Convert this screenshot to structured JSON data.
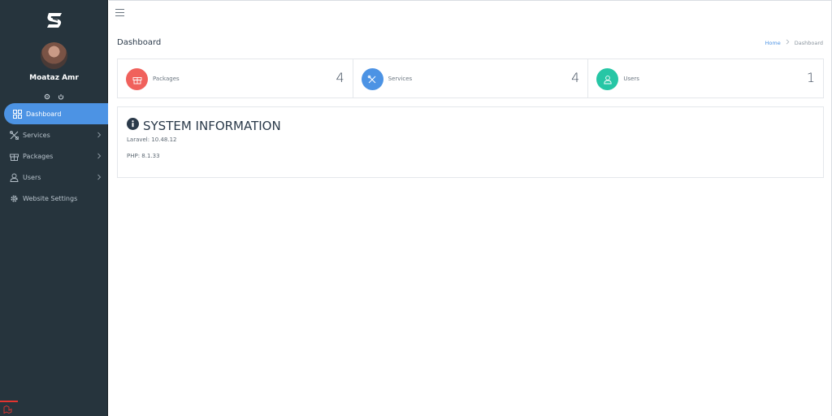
{
  "sidebar": {
    "username": "Moataz Amr",
    "menu": [
      {
        "label": "Dashboard",
        "icon": "grid-icon",
        "active": true,
        "has_children": false
      },
      {
        "label": "Services",
        "icon": "tools-icon",
        "active": false,
        "has_children": true
      },
      {
        "label": "Packages",
        "icon": "gift-icon",
        "active": false,
        "has_children": true
      },
      {
        "label": "Users",
        "icon": "user-icon",
        "active": false,
        "has_children": true
      },
      {
        "label": "Website Settings",
        "icon": "gear-icon",
        "active": false,
        "has_children": false
      }
    ]
  },
  "header": {
    "title": "Dashboard",
    "breadcrumb": {
      "home": "Home",
      "current": "Dashboard"
    }
  },
  "stats": [
    {
      "label": "Packages",
      "count": "4",
      "color": "#f0615c",
      "icon": "gift-icon"
    },
    {
      "label": "Services",
      "count": "4",
      "color": "#4c93e4",
      "icon": "tools-icon"
    },
    {
      "label": "Users",
      "count": "1",
      "color": "#26c6a5",
      "icon": "user-icon"
    }
  ],
  "system_info": {
    "title": "SYSTEM INFORMATION",
    "laravel": "Laravel: 10.48.12",
    "php": "PHP: 8.1.33"
  },
  "colors": {
    "sidebar_bg": "#26343d",
    "accent": "#4c93e4"
  }
}
